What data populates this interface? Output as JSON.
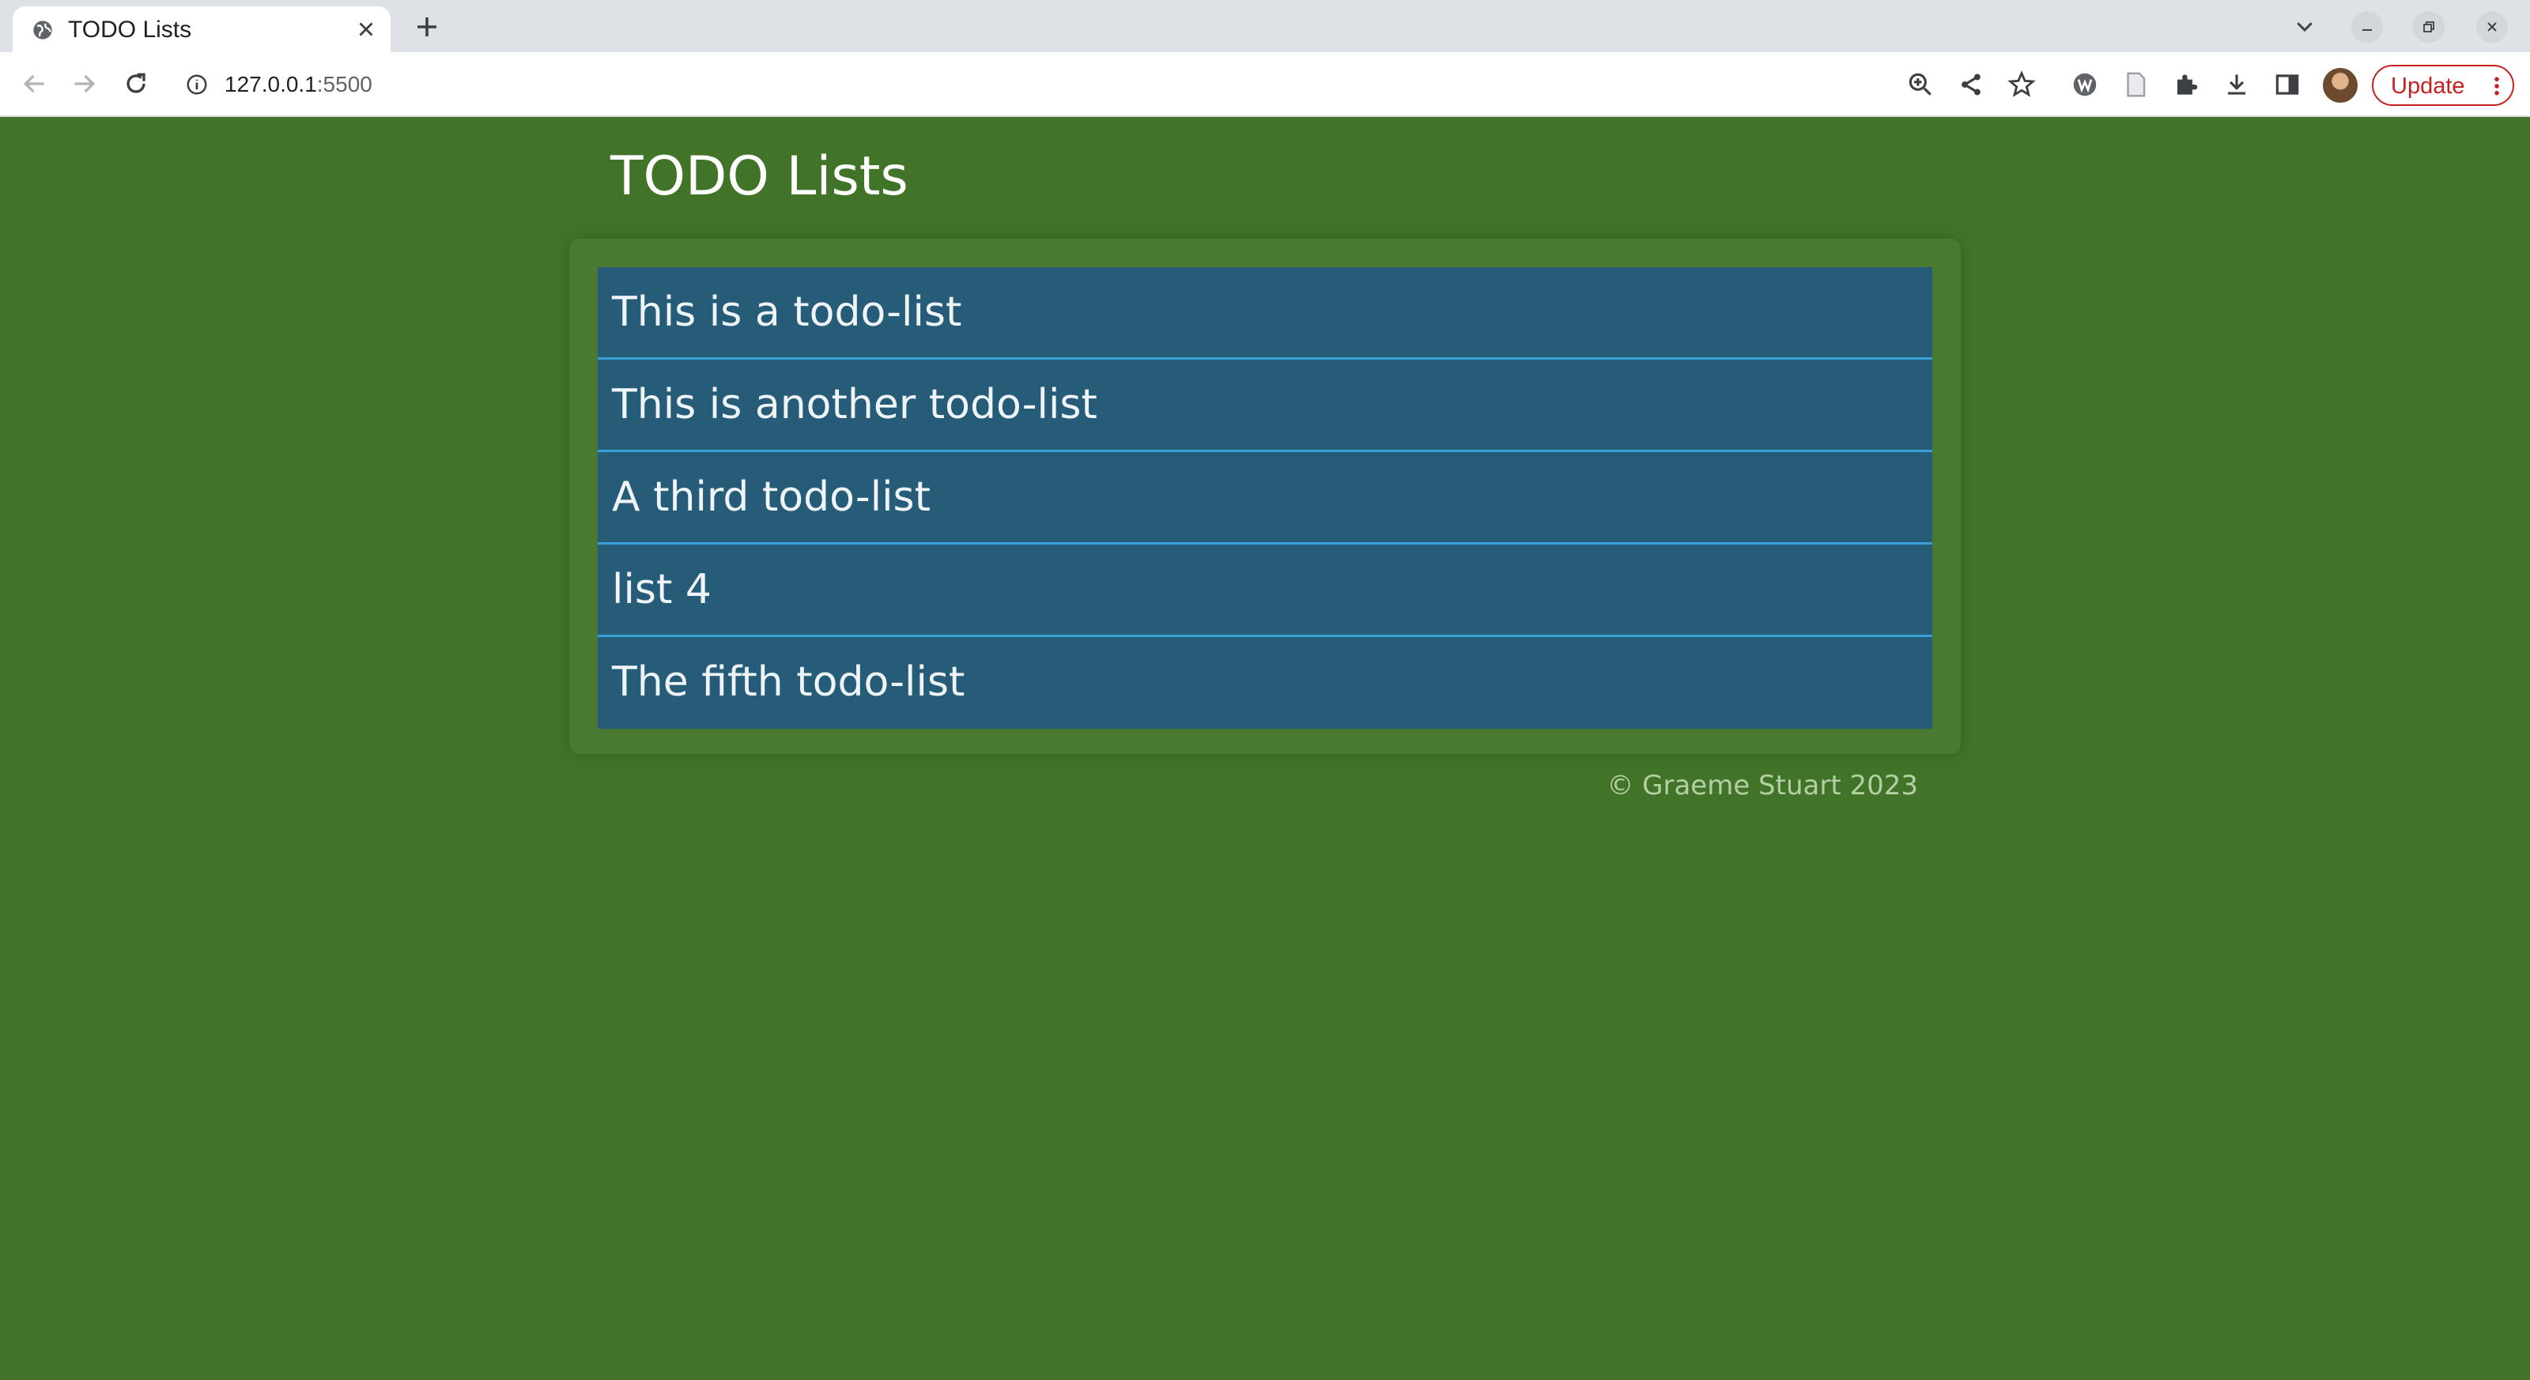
{
  "browser": {
    "tab": {
      "title": "TODO Lists",
      "favicon": "globe-icon"
    },
    "url": {
      "host": "127.0.0.1",
      "port": ":5500"
    },
    "update_label": "Update",
    "accent": "#c5221f"
  },
  "page": {
    "title": "TODO Lists",
    "background": "#417428",
    "lists": [
      {
        "label": "This is a todo-list"
      },
      {
        "label": "This is another todo-list"
      },
      {
        "label": "A third todo-list"
      },
      {
        "label": "list 4"
      },
      {
        "label": "The fifth todo-list"
      }
    ],
    "list_color": "#265c77",
    "footer": "© Graeme Stuart 2023"
  }
}
